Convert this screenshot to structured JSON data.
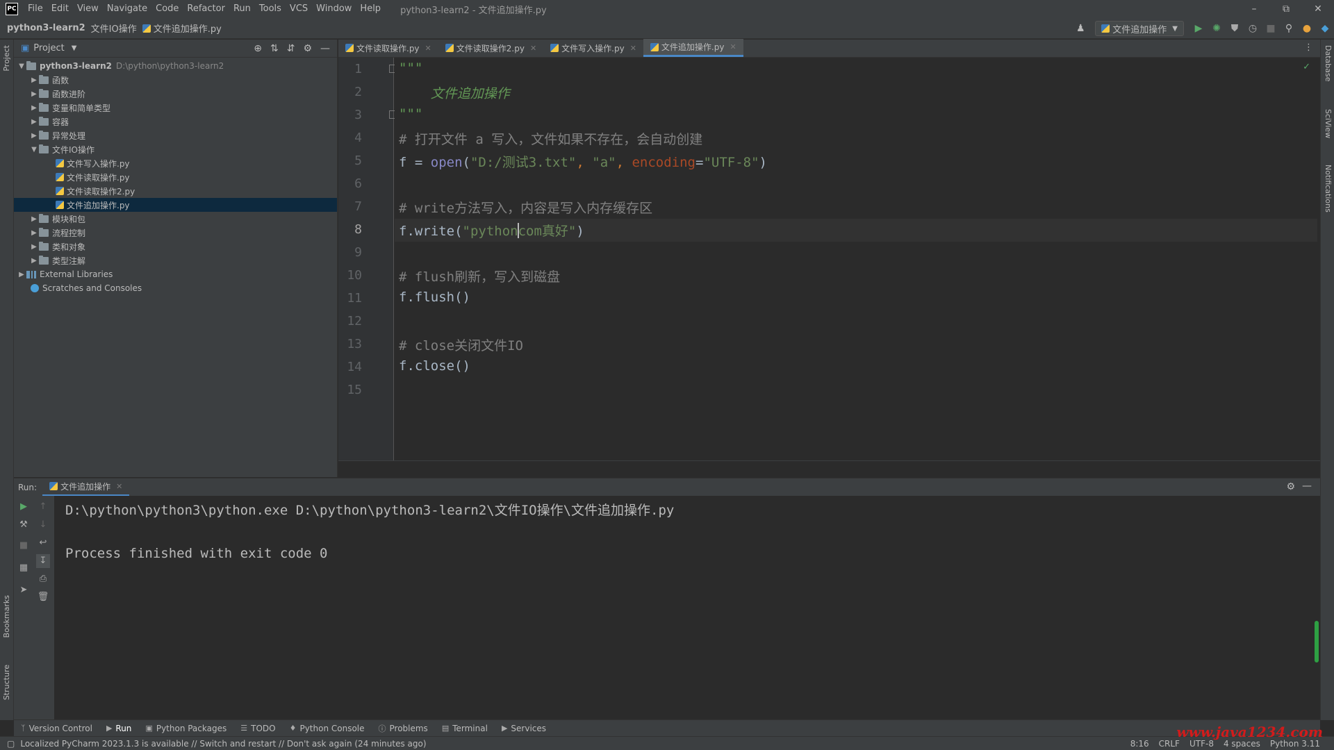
{
  "app": {
    "logo": "PC",
    "menu": [
      "File",
      "Edit",
      "View",
      "Navigate",
      "Code",
      "Refactor",
      "Run",
      "Tools",
      "VCS",
      "Window",
      "Help"
    ],
    "window_title": "python3-learn2 - 文件追加操作.py"
  },
  "breadcrumb": {
    "project": "python3-learn2",
    "folder": "文件IO操作",
    "file": "文件追加操作.py"
  },
  "run_config": {
    "name": "文件追加操作"
  },
  "side_strips": {
    "left_top": "Project",
    "left_bookmarks": "Bookmarks",
    "left_structure": "Structure",
    "right_database": "Database",
    "right_sciview": "SciView",
    "right_notifications": "Notifications"
  },
  "project_panel": {
    "title": "Project",
    "root": {
      "name": "python3-learn2",
      "path": "D:\\python\\python3-learn2"
    },
    "items": [
      {
        "label": "函数"
      },
      {
        "label": "函数进阶"
      },
      {
        "label": "变量和简单类型"
      },
      {
        "label": "容器"
      },
      {
        "label": "异常处理"
      },
      {
        "label": "文件IO操作"
      },
      {
        "label": "文件写入操作.py"
      },
      {
        "label": "文件读取操作.py"
      },
      {
        "label": "文件读取操作2.py"
      },
      {
        "label": "文件追加操作.py"
      },
      {
        "label": "模块和包"
      },
      {
        "label": "流程控制"
      },
      {
        "label": "类和对象"
      },
      {
        "label": "类型注解"
      },
      {
        "label": "External Libraries"
      },
      {
        "label": "Scratches and Consoles"
      }
    ]
  },
  "editor_tabs": [
    {
      "label": "文件读取操作.py"
    },
    {
      "label": "文件读取操作2.py"
    },
    {
      "label": "文件写入操作.py"
    },
    {
      "label": "文件追加操作.py"
    }
  ],
  "editor": {
    "line_numbers": [
      "1",
      "2",
      "3",
      "4",
      "5",
      "6",
      "7",
      "8",
      "9",
      "10",
      "11",
      "12",
      "13",
      "14",
      "15"
    ],
    "code": {
      "l1": "\"\"\"",
      "l2": "    文件追加操作",
      "l3": "\"\"\"",
      "l4": "# 打开文件 a 写入，文件如果不存在，会自动创建",
      "l5_var": "f = ",
      "l5_fn": "open",
      "l5_p1": "(",
      "l5_s1": "\"D:/测试3.txt\"",
      "l5_c1": ", ",
      "l5_s2": "\"a\"",
      "l5_c2": ", ",
      "l5_kw": "encoding",
      "l5_eq": "=",
      "l5_s3": "\"UTF-8\"",
      "l5_p2": ")",
      "l7": "# write方法写入，内容是写入内存缓存区",
      "l8_a": "f.write(",
      "l8_s1": "\"python",
      "l8_s2": "com真好\"",
      "l8_b": ")",
      "l10": "# flush刷新，写入到磁盘",
      "l11": "f.flush()",
      "l13": "# close关闭文件IO",
      "l14": "f.close()"
    }
  },
  "run_panel": {
    "label": "Run:",
    "tab": "文件追加操作",
    "console": [
      "D:\\python\\python3\\python.exe D:\\python\\python3-learn2\\文件IO操作\\文件追加操作.py",
      "",
      "Process finished with exit code 0"
    ]
  },
  "tool_windows": [
    {
      "label": "Version Control",
      "icon": "branch-icon"
    },
    {
      "label": "Run",
      "icon": "play-icon"
    },
    {
      "label": "Python Packages",
      "icon": "package-icon"
    },
    {
      "label": "TODO",
      "icon": "list-icon"
    },
    {
      "label": "Python Console",
      "icon": "python-icon"
    },
    {
      "label": "Problems",
      "icon": "problem-icon"
    },
    {
      "label": "Terminal",
      "icon": "terminal-icon"
    },
    {
      "label": "Services",
      "icon": "services-icon"
    }
  ],
  "status": {
    "message": "Localized PyCharm 2023.1.3 is available // Switch and restart // Don't ask again (24 minutes ago)",
    "position": "8:16",
    "line_sep": "CRLF",
    "encoding": "UTF-8",
    "indent": "4 spaces",
    "interpreter": "Python 3.11"
  },
  "watermark": "www.java1234.com",
  "colors": {
    "accent": "#4a88c7",
    "selection": "#0d293e",
    "string": "#6a8759",
    "comment": "#808080",
    "keyword_arg": "#aa4926"
  }
}
